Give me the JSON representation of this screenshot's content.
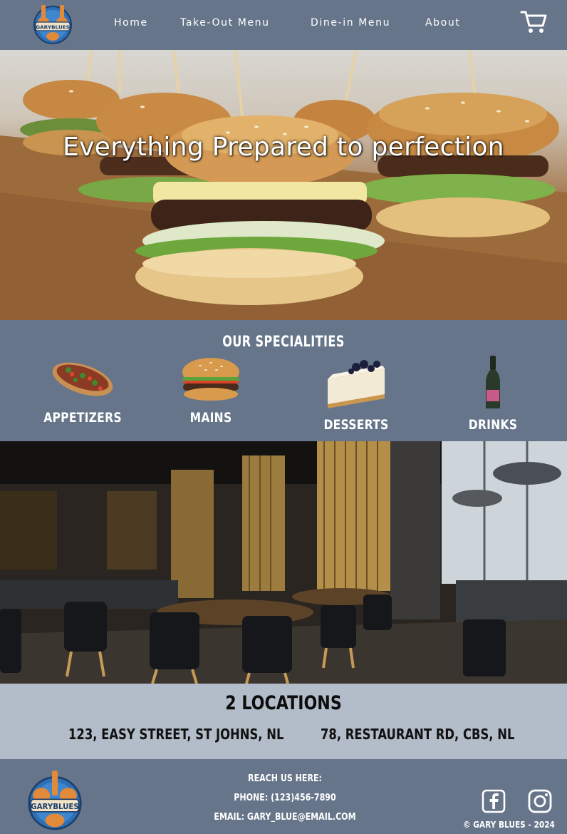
{
  "brand": {
    "logo_text": "GARYBLUES",
    "logo_icon": "guitar-badge-logo"
  },
  "nav": {
    "links": [
      {
        "label": "Home"
      },
      {
        "label": "Take-Out Menu"
      },
      {
        "label": "Dine-in Menu"
      },
      {
        "label": "About"
      }
    ],
    "cart_icon": "shopping-cart-icon"
  },
  "hero": {
    "title": "Everything Prepared to perfection"
  },
  "specialities": {
    "title": "OUR SPECIALITIES",
    "items": [
      {
        "label": "APPETIZERS",
        "icon": "bruschetta-icon"
      },
      {
        "label": "MAINS",
        "icon": "burger-icon"
      },
      {
        "label": "DESSERTS",
        "icon": "cheesecake-icon"
      },
      {
        "label": "DRINKS",
        "icon": "wine-bottle-icon"
      }
    ]
  },
  "locations": {
    "title": "2 LOCATIONS",
    "addresses": [
      "123, EASY STREET, ST JOHNS, NL",
      "78, RESTAURANT RD, CBS, NL"
    ]
  },
  "footer": {
    "reach_title": "REACH US HERE:",
    "phone": "PHONE:  (123)456-7890",
    "email": "EMAIL: GARY_BLUE@EMAIL.COM",
    "copyright": "GARY BLUES - 2024",
    "copyright_symbol": "©",
    "social_icons": [
      "facebook-icon",
      "instagram-icon"
    ]
  },
  "colors": {
    "nav_bg": "#66758a",
    "locations_bg": "#b2bdc9",
    "text_light": "#ffffff",
    "logo_blue": "#2f6fb5",
    "logo_orange": "#e08a3a"
  }
}
